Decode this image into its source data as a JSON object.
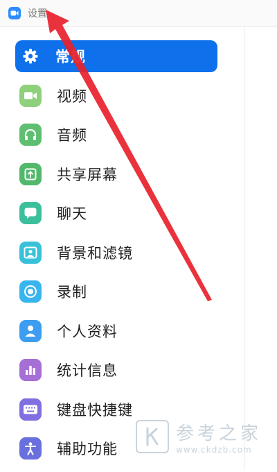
{
  "window": {
    "title": "设置"
  },
  "sidebar": {
    "items": [
      {
        "label": "常规",
        "icon": "gear-icon",
        "color": "#0e71eb",
        "active": true
      },
      {
        "label": "视频",
        "icon": "video-camera-icon",
        "color": "#8fd07d"
      },
      {
        "label": "音频",
        "icon": "headphones-icon",
        "color": "#5fbf70"
      },
      {
        "label": "共享屏幕",
        "icon": "share-screen-icon",
        "color": "#52b86b"
      },
      {
        "label": "聊天",
        "icon": "chat-bubble-icon",
        "color": "#3cbf9c"
      },
      {
        "label": "背景和滤镜",
        "icon": "background-filter-icon",
        "color": "#38c1d8"
      },
      {
        "label": "录制",
        "icon": "record-icon",
        "color": "#39b5ee"
      },
      {
        "label": "个人资料",
        "icon": "profile-icon",
        "color": "#3d9df0"
      },
      {
        "label": "统计信息",
        "icon": "statistics-icon",
        "color": "#a66fd6"
      },
      {
        "label": "键盘快捷键",
        "icon": "keyboard-icon",
        "color": "#7f6fe0"
      },
      {
        "label": "辅助功能",
        "icon": "accessibility-icon",
        "color": "#6a6fde"
      }
    ]
  },
  "watermark": {
    "title": "参考之家",
    "url": "www.ckdzb.com"
  },
  "annotation": {
    "arrow_color": "#e8212b"
  }
}
